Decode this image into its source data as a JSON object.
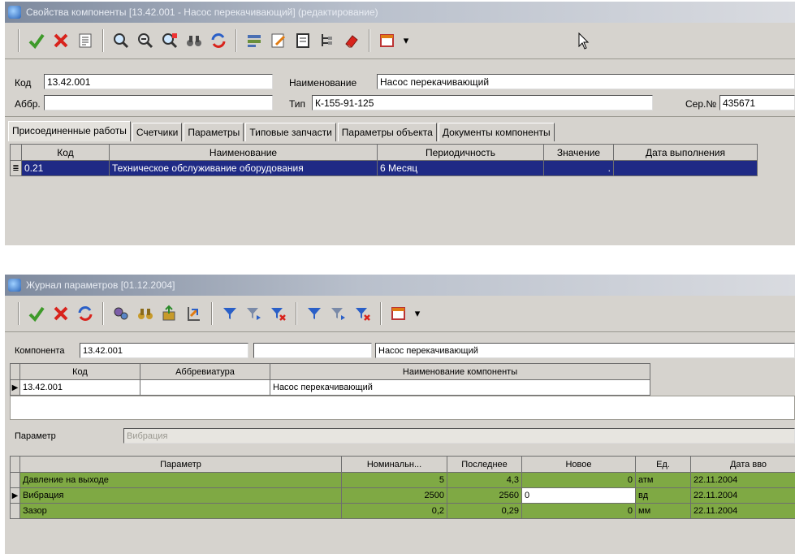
{
  "window1": {
    "title": "Свойства компоненты [13.42.001 - Насос перекачивающий] (редактирование)",
    "toolbar_icons": [
      "check-icon",
      "close-icon",
      "list-icon",
      "zoom-in-icon",
      "zoom-out-icon",
      "zoom-all-icon",
      "binoculars-icon",
      "refresh-icon",
      "settings-icon",
      "edit-icon",
      "document-icon",
      "tree-icon",
      "eraser-icon",
      "window-icon",
      "dropdown-arrow-icon"
    ],
    "fields": {
      "code_label": "Код",
      "code_value": "13.42.001",
      "abbr_label": "Аббр.",
      "abbr_value": "",
      "name_label": "Наименование",
      "name_value": "Насос перекачивающий",
      "type_label": "Тип",
      "type_value": "К-155-91-125",
      "serial_label": "Сер.№",
      "serial_value": "435671"
    },
    "tabs": [
      "Присоединенные работы",
      "Счетчики",
      "Параметры",
      "Типовые запчасти",
      "Параметры объекта",
      "Документы компоненты"
    ],
    "grid": {
      "columns": [
        "Код",
        "Наименование",
        "Периодичность",
        "Значение",
        "Дата выполнения"
      ],
      "rows": [
        {
          "indicator": "≣",
          "code": "0.21",
          "name": "Техническое обслуживание оборудования",
          "period": "6 Месяц",
          "value": ".",
          "date": ""
        }
      ]
    }
  },
  "window2": {
    "title": "Журнал параметров [01.12.2004]",
    "toolbar_icons": [
      "check-icon",
      "close-icon",
      "refresh-icon",
      "gears-icon",
      "binoculars-icon",
      "export-icon",
      "import-icon",
      "filter-icon",
      "filter-next-icon",
      "filter-clear-icon",
      "filter-icon",
      "filter-next-icon",
      "filter-clear-icon",
      "window-icon",
      "dropdown-arrow-icon"
    ],
    "component": {
      "label": "Компонента",
      "code_value": "13.42.001",
      "mid_value": "",
      "name_value": "Насос перекачивающий"
    },
    "component_grid": {
      "columns": [
        "Код",
        "Аббревиатура",
        "Наименование компоненты"
      ],
      "rows": [
        {
          "indicator": "▶",
          "code": "13.42.001",
          "abbr": "",
          "name": "Насос перекачивающий"
        }
      ]
    },
    "parameter_filter": {
      "label": "Параметр",
      "value": "Вибрация"
    },
    "param_grid": {
      "columns": [
        "Параметр",
        "Номинальн...",
        "Последнее",
        "Новое",
        "Ед.",
        "Дата вво"
      ],
      "rows": [
        {
          "indicator": "",
          "param": "Давление на выходе",
          "nominal": "5",
          "last": "4,3",
          "new": "0",
          "unit": "атм",
          "date": "22.11.2004"
        },
        {
          "indicator": "▶",
          "param": "Вибрация",
          "nominal": "2500",
          "last": "2560",
          "new": "0",
          "unit": "вд",
          "date": "22.11.2004"
        },
        {
          "indicator": "",
          "param": "Зазор",
          "nominal": "0,2",
          "last": "0,29",
          "new": "0",
          "unit": "мм",
          "date": "22.11.2004"
        }
      ]
    }
  }
}
